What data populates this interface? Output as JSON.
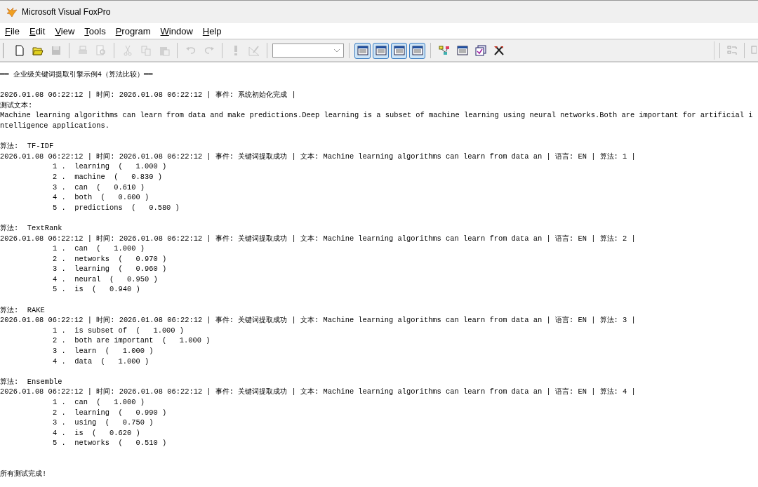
{
  "window": {
    "title": "Microsoft Visual FoxPro"
  },
  "menu": [
    "File",
    "Edit",
    "View",
    "Tools",
    "Program",
    "Window",
    "Help"
  ],
  "toolbar": [
    [
      {
        "kind": "new",
        "disabled": false
      },
      {
        "kind": "open",
        "disabled": false
      },
      {
        "kind": "save",
        "disabled": true
      }
    ],
    [
      {
        "kind": "print",
        "disabled": true
      },
      {
        "kind": "preview",
        "disabled": true
      }
    ],
    [
      {
        "kind": "cut",
        "disabled": true
      },
      {
        "kind": "copy",
        "disabled": true
      },
      {
        "kind": "paste",
        "disabled": true
      }
    ],
    [
      {
        "kind": "undo",
        "disabled": true
      },
      {
        "kind": "redo",
        "disabled": true
      }
    ],
    [
      {
        "kind": "run",
        "disabled": true
      },
      {
        "kind": "modify",
        "disabled": true
      }
    ],
    [
      {
        "kind": "combo"
      }
    ],
    [
      {
        "kind": "window",
        "disabled": false,
        "pressed": true
      },
      {
        "kind": "datasession",
        "disabled": false,
        "pressed": true
      },
      {
        "kind": "properties",
        "disabled": false,
        "pressed": true
      },
      {
        "kind": "find",
        "disabled": false,
        "pressed": true
      }
    ],
    [
      {
        "kind": "diagram",
        "disabled": false
      },
      {
        "kind": "form",
        "disabled": false
      },
      {
        "kind": "wizard",
        "disabled": false
      },
      {
        "kind": "tools",
        "disabled": false
      }
    ]
  ],
  "output": {
    "header": "══ 企业级关键词提取引擎示例4（算法比较）══",
    "init_log": "2026.01.08 06:22:12 | 时间: 2026.01.08 06:22:12 | 事件: 系统初始化完成 |",
    "test_label": "测试文本:",
    "test_text": "Machine learning algorithms can learn from data and make predictions.Deep learning is a subset of machine learning using neural networks.Both are important for artificial intelligence applications.",
    "sections": [
      {
        "algorithm": "算法:  TF-IDF",
        "log": "2026.01.08 06:22:12 | 时间: 2026.01.08 06:22:12 | 事件: 关键词提取成功 | 文本: Machine learning algorithms can learn from data an | 语言: EN | 算法: 1 |",
        "keywords": [
          "1 .  learning  (   1.000 )",
          "2 .  machine  (   0.830 )",
          "3 .  can  (   0.610 )",
          "4 .  both  (   0.600 )",
          "5 .  predictions  (   0.580 )"
        ]
      },
      {
        "algorithm": "算法:  TextRank",
        "log": "2026.01.08 06:22:12 | 时间: 2026.01.08 06:22:12 | 事件: 关键词提取成功 | 文本: Machine learning algorithms can learn from data an | 语言: EN | 算法: 2 |",
        "keywords": [
          "1 .  can  (   1.000 )",
          "2 .  networks  (   0.970 )",
          "3 .  learning  (   0.960 )",
          "4 .  neural  (   0.950 )",
          "5 .  is  (   0.940 )"
        ]
      },
      {
        "algorithm": "算法:  RAKE",
        "log": "2026.01.08 06:22:12 | 时间: 2026.01.08 06:22:12 | 事件: 关键词提取成功 | 文本: Machine learning algorithms can learn from data an | 语言: EN | 算法: 3 |",
        "keywords": [
          "1 .  is subset of  (   1.000 )",
          "2 .  both are important  (   1.000 )",
          "3 .  learn  (   1.000 )",
          "4 .  data  (   1.000 )"
        ]
      },
      {
        "algorithm": "算法:  Ensemble",
        "log": "2026.01.08 06:22:12 | 时间: 2026.01.08 06:22:12 | 事件: 关键词提取成功 | 文本: Machine learning algorithms can learn from data an | 语言: EN | 算法: 4 |",
        "keywords": [
          "1 .  can  (   1.000 )",
          "2 .  learning  (   0.990 )",
          "3 .  using  (   0.750 )",
          "4 .  is  (   0.620 )",
          "5 .  networks  (   0.510 )"
        ]
      }
    ],
    "footer": "所有测试完成!"
  }
}
